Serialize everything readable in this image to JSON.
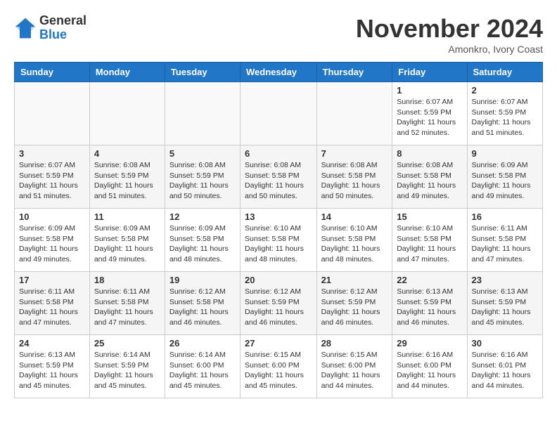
{
  "header": {
    "logo_general": "General",
    "logo_blue": "Blue",
    "month_title": "November 2024",
    "location": "Amonkro, Ivory Coast"
  },
  "weekdays": [
    "Sunday",
    "Monday",
    "Tuesday",
    "Wednesday",
    "Thursday",
    "Friday",
    "Saturday"
  ],
  "weeks": [
    [
      {
        "day": "",
        "info": ""
      },
      {
        "day": "",
        "info": ""
      },
      {
        "day": "",
        "info": ""
      },
      {
        "day": "",
        "info": ""
      },
      {
        "day": "",
        "info": ""
      },
      {
        "day": "1",
        "info": "Sunrise: 6:07 AM\nSunset: 5:59 PM\nDaylight: 11 hours and 52 minutes."
      },
      {
        "day": "2",
        "info": "Sunrise: 6:07 AM\nSunset: 5:59 PM\nDaylight: 11 hours and 51 minutes."
      }
    ],
    [
      {
        "day": "3",
        "info": "Sunrise: 6:07 AM\nSunset: 5:59 PM\nDaylight: 11 hours and 51 minutes."
      },
      {
        "day": "4",
        "info": "Sunrise: 6:08 AM\nSunset: 5:59 PM\nDaylight: 11 hours and 51 minutes."
      },
      {
        "day": "5",
        "info": "Sunrise: 6:08 AM\nSunset: 5:59 PM\nDaylight: 11 hours and 50 minutes."
      },
      {
        "day": "6",
        "info": "Sunrise: 6:08 AM\nSunset: 5:58 PM\nDaylight: 11 hours and 50 minutes."
      },
      {
        "day": "7",
        "info": "Sunrise: 6:08 AM\nSunset: 5:58 PM\nDaylight: 11 hours and 50 minutes."
      },
      {
        "day": "8",
        "info": "Sunrise: 6:08 AM\nSunset: 5:58 PM\nDaylight: 11 hours and 49 minutes."
      },
      {
        "day": "9",
        "info": "Sunrise: 6:09 AM\nSunset: 5:58 PM\nDaylight: 11 hours and 49 minutes."
      }
    ],
    [
      {
        "day": "10",
        "info": "Sunrise: 6:09 AM\nSunset: 5:58 PM\nDaylight: 11 hours and 49 minutes."
      },
      {
        "day": "11",
        "info": "Sunrise: 6:09 AM\nSunset: 5:58 PM\nDaylight: 11 hours and 49 minutes."
      },
      {
        "day": "12",
        "info": "Sunrise: 6:09 AM\nSunset: 5:58 PM\nDaylight: 11 hours and 48 minutes."
      },
      {
        "day": "13",
        "info": "Sunrise: 6:10 AM\nSunset: 5:58 PM\nDaylight: 11 hours and 48 minutes."
      },
      {
        "day": "14",
        "info": "Sunrise: 6:10 AM\nSunset: 5:58 PM\nDaylight: 11 hours and 48 minutes."
      },
      {
        "day": "15",
        "info": "Sunrise: 6:10 AM\nSunset: 5:58 PM\nDaylight: 11 hours and 47 minutes."
      },
      {
        "day": "16",
        "info": "Sunrise: 6:11 AM\nSunset: 5:58 PM\nDaylight: 11 hours and 47 minutes."
      }
    ],
    [
      {
        "day": "17",
        "info": "Sunrise: 6:11 AM\nSunset: 5:58 PM\nDaylight: 11 hours and 47 minutes."
      },
      {
        "day": "18",
        "info": "Sunrise: 6:11 AM\nSunset: 5:58 PM\nDaylight: 11 hours and 47 minutes."
      },
      {
        "day": "19",
        "info": "Sunrise: 6:12 AM\nSunset: 5:58 PM\nDaylight: 11 hours and 46 minutes."
      },
      {
        "day": "20",
        "info": "Sunrise: 6:12 AM\nSunset: 5:59 PM\nDaylight: 11 hours and 46 minutes."
      },
      {
        "day": "21",
        "info": "Sunrise: 6:12 AM\nSunset: 5:59 PM\nDaylight: 11 hours and 46 minutes."
      },
      {
        "day": "22",
        "info": "Sunrise: 6:13 AM\nSunset: 5:59 PM\nDaylight: 11 hours and 46 minutes."
      },
      {
        "day": "23",
        "info": "Sunrise: 6:13 AM\nSunset: 5:59 PM\nDaylight: 11 hours and 45 minutes."
      }
    ],
    [
      {
        "day": "24",
        "info": "Sunrise: 6:13 AM\nSunset: 5:59 PM\nDaylight: 11 hours and 45 minutes."
      },
      {
        "day": "25",
        "info": "Sunrise: 6:14 AM\nSunset: 5:59 PM\nDaylight: 11 hours and 45 minutes."
      },
      {
        "day": "26",
        "info": "Sunrise: 6:14 AM\nSunset: 6:00 PM\nDaylight: 11 hours and 45 minutes."
      },
      {
        "day": "27",
        "info": "Sunrise: 6:15 AM\nSunset: 6:00 PM\nDaylight: 11 hours and 45 minutes."
      },
      {
        "day": "28",
        "info": "Sunrise: 6:15 AM\nSunset: 6:00 PM\nDaylight: 11 hours and 44 minutes."
      },
      {
        "day": "29",
        "info": "Sunrise: 6:16 AM\nSunset: 6:00 PM\nDaylight: 11 hours and 44 minutes."
      },
      {
        "day": "30",
        "info": "Sunrise: 6:16 AM\nSunset: 6:01 PM\nDaylight: 11 hours and 44 minutes."
      }
    ]
  ]
}
